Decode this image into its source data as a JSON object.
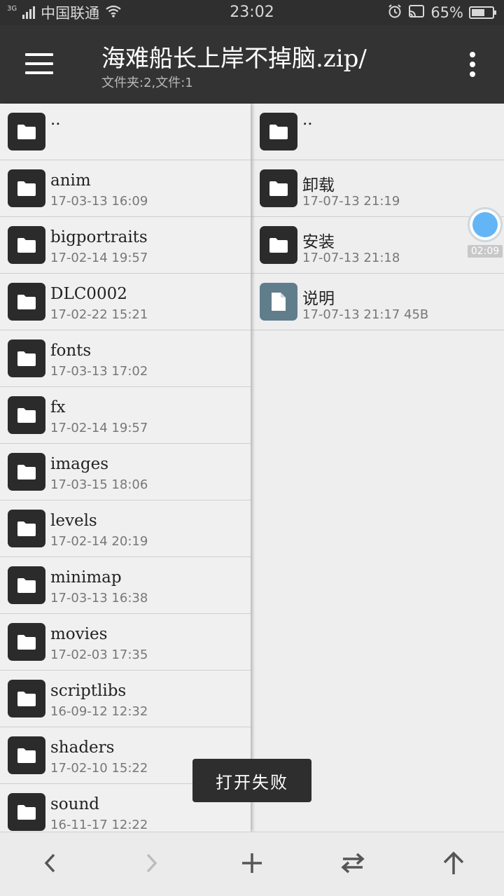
{
  "status_bar": {
    "network": "3G",
    "carrier": "中国联通",
    "time": "23:02",
    "battery": "65%",
    "battery_level": 0.65
  },
  "app_bar": {
    "menu_icon": "hamburger-menu-icon",
    "title": "海难船长上岸不掉脑.zip/",
    "subtitle": "文件夹:2,文件:1",
    "more_icon": "more-vert-icon"
  },
  "left_pane": {
    "items": [
      {
        "name": "..",
        "meta": "",
        "icon": "folder-icon"
      },
      {
        "name": "anim",
        "meta": "17-03-13 16:09",
        "icon": "folder-icon"
      },
      {
        "name": "bigportraits",
        "meta": "17-02-14 19:57",
        "icon": "folder-icon"
      },
      {
        "name": "DLC0002",
        "meta": "17-02-22 15:21",
        "icon": "folder-icon"
      },
      {
        "name": "fonts",
        "meta": "17-03-13 17:02",
        "icon": "folder-icon"
      },
      {
        "name": "fx",
        "meta": "17-02-14 19:57",
        "icon": "folder-icon"
      },
      {
        "name": "images",
        "meta": "17-03-15 18:06",
        "icon": "folder-icon"
      },
      {
        "name": "levels",
        "meta": "17-02-14 20:19",
        "icon": "folder-icon"
      },
      {
        "name": "minimap",
        "meta": "17-03-13 16:38",
        "icon": "folder-icon"
      },
      {
        "name": "movies",
        "meta": "17-02-03 17:35",
        "icon": "folder-icon"
      },
      {
        "name": "scriptlibs",
        "meta": "16-09-12 12:32",
        "icon": "folder-icon"
      },
      {
        "name": "shaders",
        "meta": "17-02-10 15:22",
        "icon": "folder-icon"
      },
      {
        "name": "sound",
        "meta": "16-11-17 12:22",
        "icon": "folder-icon"
      }
    ]
  },
  "right_pane": {
    "items": [
      {
        "name": "..",
        "meta": "",
        "icon": "folder-icon"
      },
      {
        "name": "卸载",
        "meta": "17-07-13 21:19",
        "icon": "folder-icon"
      },
      {
        "name": "安装",
        "meta": "17-07-13 21:18",
        "icon": "folder-icon"
      },
      {
        "name": "说明",
        "meta": "17-07-13 21:17  45B",
        "icon": "document-icon"
      }
    ]
  },
  "recorder": {
    "time": "02:09"
  },
  "toast": {
    "message": "打开失败"
  },
  "bottom_bar": {
    "back_icon": "chevron-left-icon",
    "forward_icon": "chevron-right-icon",
    "add_icon": "plus-icon",
    "swap_icon": "swap-horizontal-icon",
    "up_icon": "arrow-up-icon"
  },
  "colors": {
    "bar": "#333333",
    "folder_icon_bg": "#2b2b2b",
    "document_icon_bg": "#607d8b",
    "recorder_accent": "#64b5f6"
  }
}
